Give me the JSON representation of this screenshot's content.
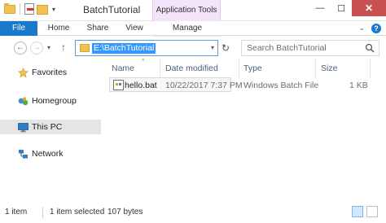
{
  "window": {
    "title": "BatchTutorial",
    "contextual_tab_group": "Application Tools",
    "minimize_glyph": "—",
    "maximize_glyph": "☐",
    "close_glyph": "✕"
  },
  "ribbon": {
    "tabs": [
      "File",
      "Home",
      "Share",
      "View",
      "Manage"
    ],
    "expand_glyph": "⌄",
    "help_glyph": "?"
  },
  "nav": {
    "back_glyph": "←",
    "forward_glyph": "→",
    "recent_glyph": "▾",
    "up_glyph": "↑",
    "address": "E:\\BatchTutorial",
    "address_dd_glyph": "▾",
    "refresh_glyph": "↻",
    "search_placeholder": "Search BatchTutorial"
  },
  "navpane": {
    "items": [
      {
        "label": "Favorites",
        "icon": "star-icon"
      },
      {
        "label": "Homegroup",
        "icon": "homegroup-icon"
      },
      {
        "label": "This PC",
        "icon": "computer-icon"
      },
      {
        "label": "Network",
        "icon": "network-icon"
      }
    ]
  },
  "columns": [
    "Name",
    "Date modified",
    "Type",
    "Size"
  ],
  "sort_glyph": "^",
  "files": [
    {
      "name": "hello.bat",
      "date_modified": "10/22/2017 7:37 PM",
      "type": "Windows Batch File",
      "size": "1 KB"
    }
  ],
  "status": {
    "item_count": "1 item",
    "selection": "1 item selected",
    "selection_size": "107 bytes"
  },
  "colors": {
    "accent": "#1979ca",
    "selection": "#3399ff",
    "context_tab": "#f3e3fb",
    "close_button": "#c75050"
  }
}
